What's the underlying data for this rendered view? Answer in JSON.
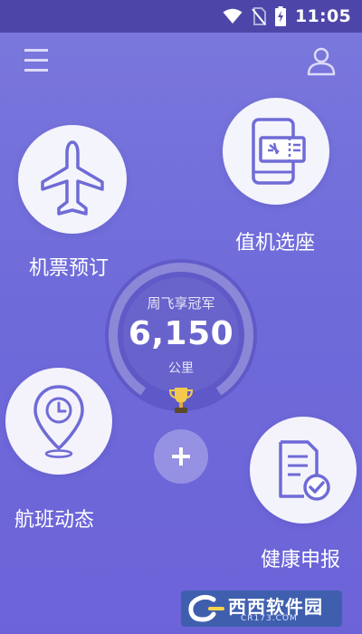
{
  "status_bar": {
    "time": "11:05",
    "icons": [
      "wifi-icon",
      "no-sim-icon",
      "battery-charging-icon"
    ]
  },
  "header": {
    "menu_icon": "menu-icon",
    "profile_icon": "user-icon"
  },
  "features": [
    {
      "id": "booking",
      "label": "机票预订",
      "icon": "airplane-icon"
    },
    {
      "id": "checkin",
      "label": "值机选座",
      "icon": "boarding-pass-phone-icon"
    },
    {
      "id": "status",
      "label": "航班动态",
      "icon": "location-clock-icon"
    },
    {
      "id": "health",
      "label": "健康申报",
      "icon": "document-check-icon"
    }
  ],
  "mileage": {
    "caption": "周飞享冠军",
    "value": "6,150",
    "unit": "公里",
    "trophy_icon": "trophy-icon"
  },
  "add_button": {
    "icon": "plus-icon"
  },
  "watermark": {
    "text": "西西软件园",
    "subtext": "CR173.COM"
  },
  "colors": {
    "background_top": "#7b78dd",
    "background_bottom": "#6c63d8",
    "status_bar": "#4d46a8",
    "icon_color": "#6f6bd6",
    "circle_fill": "#ffffff"
  }
}
